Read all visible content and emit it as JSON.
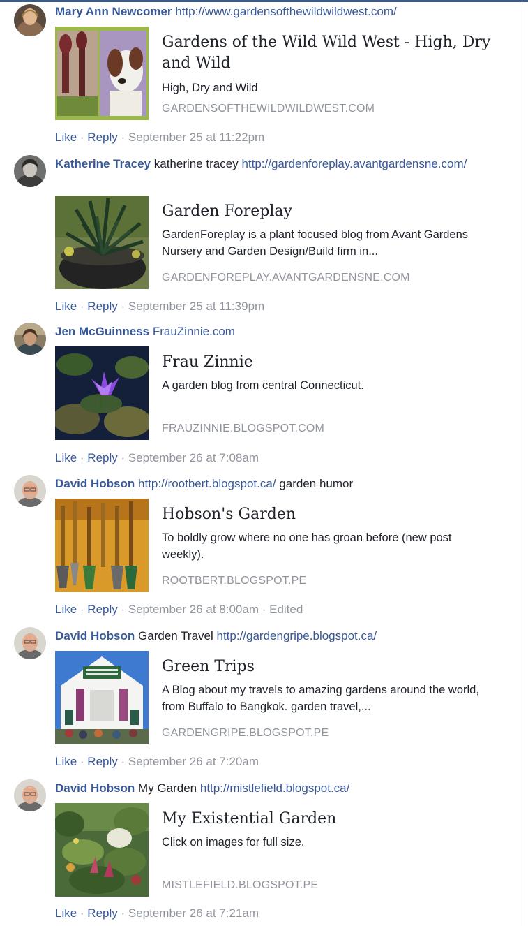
{
  "comments": [
    {
      "author": "Mary Ann Newcomer",
      "text_before": "",
      "link": "http://www.gardensofthewildwildwest.com/",
      "text_after": "",
      "avatar": "avatar-woman-icon",
      "card": {
        "title": "Gardens of the Wild Wild West - High, Dry and Wild",
        "description": "High, Dry and Wild",
        "domain": "GARDENSOFTHEWILDWILDWEST.COM",
        "thumbnail": "dog-and-flower-thumbnail"
      },
      "like": "Like",
      "reply": "Reply",
      "time": "September 25 at 11:22pm",
      "edited": ""
    },
    {
      "author": "Katherine Tracey",
      "text_before": "katherine tracey",
      "link": "http://gardenforeplay.avantgardensne.com/",
      "text_after": "",
      "avatar": "avatar-woman-icon",
      "card": {
        "title": "Garden Foreplay",
        "description": "GardenForeplay is a plant focused blog from Avant Gardens Nursery and Garden Design/Build firm in...",
        "domain": "GARDENFOREPLAY.AVANTGARDENSNE.COM",
        "thumbnail": "potted-plant-thumbnail"
      },
      "like": "Like",
      "reply": "Reply",
      "time": "September 25 at 11:39pm",
      "edited": ""
    },
    {
      "author": "Jen McGuinness",
      "text_before": "",
      "link": "FrauZinnie.com",
      "text_after": "",
      "avatar": "avatar-woman-icon",
      "card": {
        "title": "Frau Zinnie",
        "description": "A garden blog from central Connecticut.",
        "domain": "FRAUZINNIE.BLOGSPOT.COM",
        "thumbnail": "purple-flower-thumbnail"
      },
      "like": "Like",
      "reply": "Reply",
      "time": "September 26 at 7:08am",
      "edited": ""
    },
    {
      "author": "David Hobson",
      "text_before": "",
      "link": "http://rootbert.blogspot.ca/",
      "text_after": "garden humor",
      "avatar": "avatar-man-icon",
      "card": {
        "title": "Hobson's Garden",
        "description": "To boldly grow where no one has groan before (new post weekly).",
        "domain": "ROOTBERT.BLOGSPOT.PE",
        "thumbnail": "garden-tools-thumbnail"
      },
      "like": "Like",
      "reply": "Reply",
      "time": "September 26 at 8:00am",
      "edited": "Edited"
    },
    {
      "author": "David Hobson",
      "text_before": "Garden Travel",
      "link": "http://gardengripe.blogspot.ca/",
      "text_after": "",
      "avatar": "avatar-man-icon",
      "card": {
        "title": "Green Trips",
        "description": "A Blog about my travels to amazing gardens around the world, from Buffalo to Bangkok. garden travel,...",
        "domain": "GARDENGRIPE.BLOGSPOT.PE",
        "thumbnail": "garden-show-building-thumbnail"
      },
      "like": "Like",
      "reply": "Reply",
      "time": "September 26 at 7:20am",
      "edited": ""
    },
    {
      "author": "David Hobson",
      "text_before": "My Garden",
      "link": "http://mistlefield.blogspot.ca/",
      "text_after": "",
      "avatar": "avatar-man-icon",
      "card": {
        "title": "My Existential Garden",
        "description": "Click on images for full size.",
        "domain": "MISTLEFIELD.BLOGSPOT.PE",
        "thumbnail": "lush-garden-thumbnail"
      },
      "like": "Like",
      "reply": "Reply",
      "time": "September 26 at 7:21am",
      "edited": ""
    }
  ],
  "separator": " · ",
  "colors": {
    "link": "#385898",
    "text": "#1d2129",
    "muted": "#90949c"
  }
}
